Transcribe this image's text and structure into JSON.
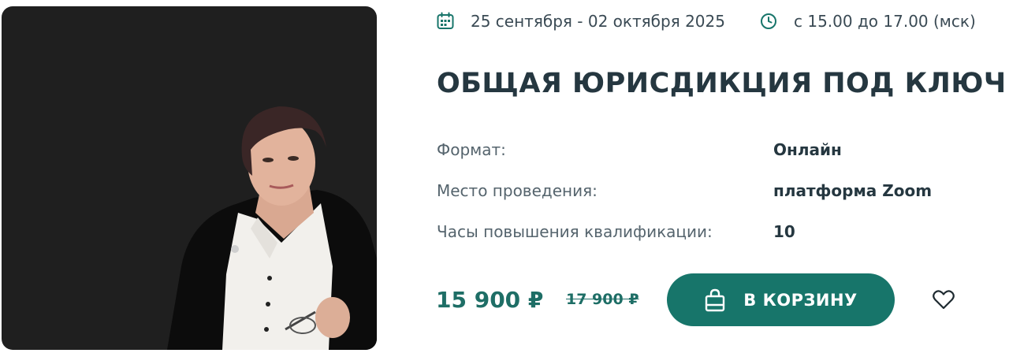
{
  "event": {
    "date_range": "25 сентября - 02 октября 2025",
    "time_range": "с 15.00 до 17.00 (мск)",
    "title": "ОБЩАЯ ЮРИСДИКЦИЯ ПОД КЛЮЧ"
  },
  "details": [
    {
      "label": "Формат:",
      "value": "Онлайн"
    },
    {
      "label": "Место проведения:",
      "value": "платформа Zoom"
    },
    {
      "label": "Часы повышения квалификации:",
      "value": "10"
    }
  ],
  "pricing": {
    "price": "15 900 ₽",
    "old_price": "17 900 ₽"
  },
  "actions": {
    "cart_label": "В КОРЗИНУ"
  },
  "icons": {
    "date": "calendar-icon",
    "time": "clock-icon",
    "cart": "shopping-bag-icon",
    "favorite": "heart-icon"
  },
  "colors": {
    "accent": "#17756a",
    "title": "#253740",
    "photo_bg": "#1f1f1f"
  }
}
